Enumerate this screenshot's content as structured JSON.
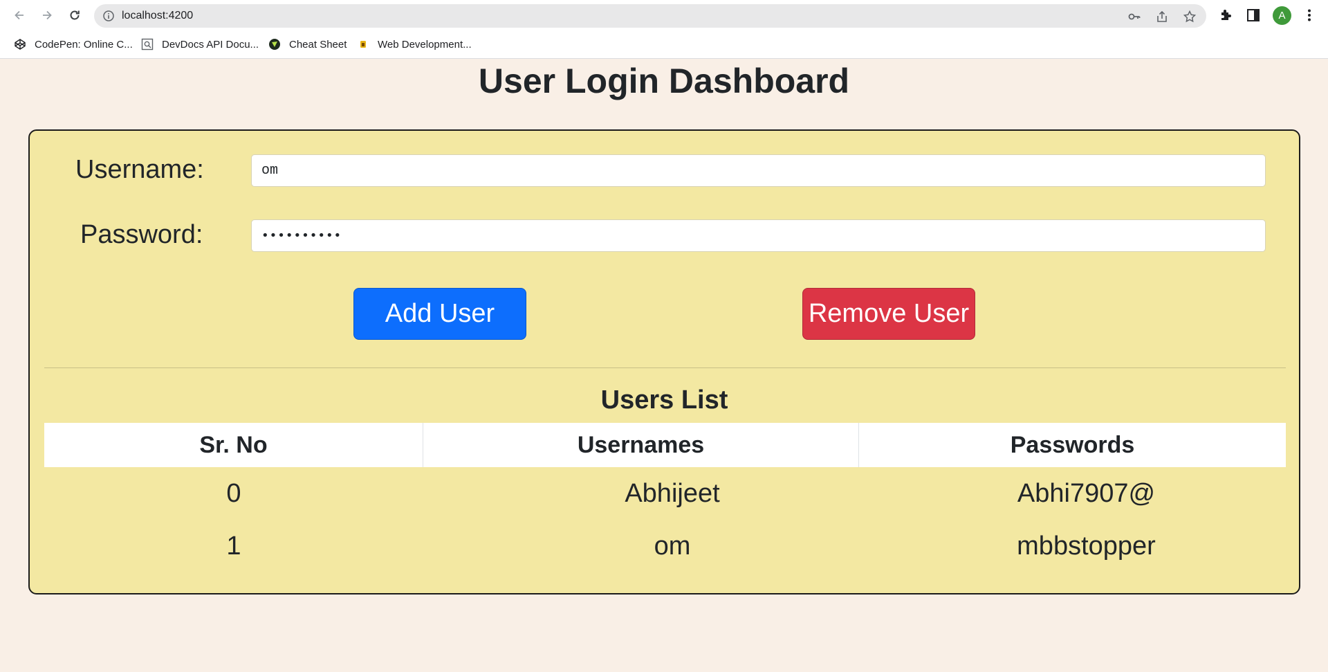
{
  "browser": {
    "url": "localhost:4200",
    "avatar_initial": "A",
    "avatar_color": "#3f9a3a",
    "nav_icons": [
      "back-arrow-icon",
      "forward-arrow-icon",
      "reload-icon"
    ],
    "omnibox_icons": [
      "site-info-icon",
      "key-icon",
      "share-icon",
      "star-icon"
    ],
    "toolbar_icons": [
      "extensions-puzzle-icon",
      "side-panel-icon",
      "kebab-menu-icon"
    ],
    "bookmarks": [
      {
        "label": "CodePen: Online C...",
        "icon": "codepen-icon"
      },
      {
        "label": "DevDocs API Docu...",
        "icon": "devdocs-icon"
      },
      {
        "label": "Cheat Sheet",
        "icon": "cheat-sheet-icon"
      },
      {
        "label": "Web Development...",
        "icon": "web-dev-icon"
      }
    ]
  },
  "page": {
    "title": "User Login Dashboard",
    "background": "#f9efe6",
    "card_color": "#f3e8a2"
  },
  "form": {
    "username_label": "Username:",
    "username_value": "om",
    "password_label": "Password:",
    "password_value": "••••••••••",
    "add_button": "Add User",
    "remove_button": "Remove User",
    "add_button_color": "#0d6efd",
    "remove_button_color": "#dc3545"
  },
  "users": {
    "title": "Users List",
    "headers": [
      "Sr. No",
      "Usernames",
      "Passwords"
    ],
    "rows": [
      [
        "0",
        "Abhijeet",
        "Abhi7907@"
      ],
      [
        "1",
        "om",
        "mbbstopper"
      ]
    ]
  }
}
